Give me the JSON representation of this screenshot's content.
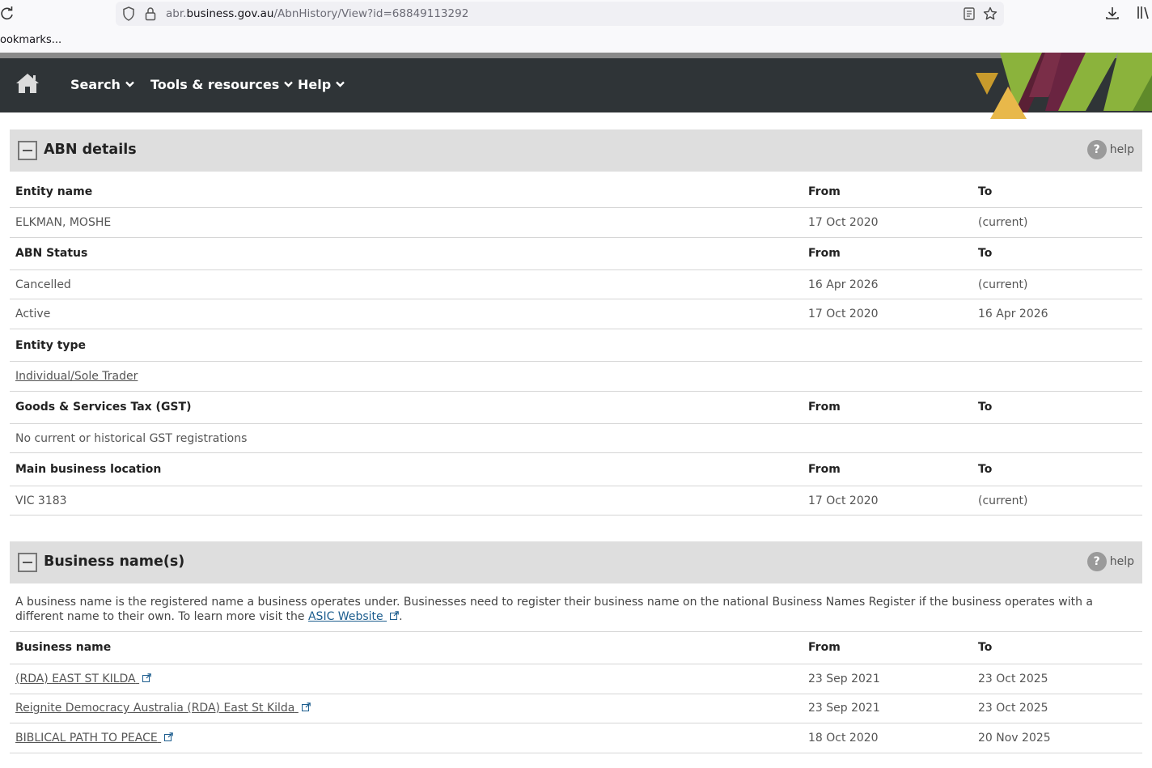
{
  "browser": {
    "url_prefix": "abr.",
    "url_domain": "business.gov.au",
    "url_path": "/AbnHistory/View?id=68849113292",
    "bookmarks_label": "ookmarks..."
  },
  "header": {
    "nav": [
      "Search",
      "Tools & resources",
      "Help"
    ],
    "bg_color": "#2f3437"
  },
  "abn_details": {
    "title": "ABN details",
    "help_label": "help",
    "entity_name": {
      "headers": [
        "Entity name",
        "From",
        "To"
      ],
      "rows": [
        [
          "ELKMAN, MOSHE",
          "17 Oct 2020",
          "(current)"
        ]
      ]
    },
    "abn_status": {
      "headers": [
        "ABN Status",
        "From",
        "To"
      ],
      "rows": [
        [
          "Cancelled",
          "16 Apr 2026",
          "(current)"
        ],
        [
          "Active",
          "17 Oct 2020",
          "16 Apr 2026"
        ]
      ]
    },
    "entity_type": {
      "header": "Entity type",
      "value": "Individual/Sole Trader"
    },
    "gst": {
      "headers": [
        "Goods & Services Tax (GST)",
        "From",
        "To"
      ],
      "value": "No current or historical GST registrations"
    },
    "location": {
      "headers": [
        "Main business location",
        "From",
        "To"
      ],
      "rows": [
        [
          "VIC 3183",
          "17 Oct 2020",
          "(current)"
        ]
      ]
    }
  },
  "business_names": {
    "title": "Business name(s)",
    "help_label": "help",
    "intro_text": "A business name is the registered name a business operates under. Businesses need to register their business name on the national Business Names Register if the business operates with a different name to their own. To learn more visit the",
    "intro_link": "ASIC Website",
    "intro_end": ".",
    "headers": [
      "Business name",
      "From",
      "To"
    ],
    "rows": [
      [
        "(RDA) EAST ST KILDA",
        "23 Sep 2021",
        "23 Oct 2025"
      ],
      [
        "Reignite Democracy Australia (RDA) East St Kilda",
        "23 Sep 2021",
        "23 Oct 2025"
      ],
      [
        "BIBLICAL PATH TO PEACE",
        "18 Oct 2020",
        "20 Nov 2025"
      ]
    ]
  }
}
